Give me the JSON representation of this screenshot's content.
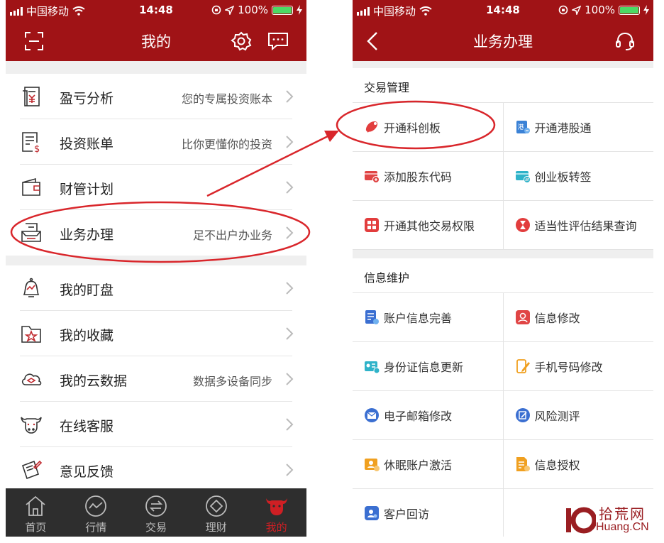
{
  "status": {
    "carrier": "中国移动",
    "time": "14:48",
    "battery": "100%"
  },
  "left": {
    "title": "我的",
    "menu": [
      {
        "label": "盈亏分析",
        "desc": "您的专属投资账本",
        "icon": "profit-analysis-icon"
      },
      {
        "label": "投资账单",
        "desc": "比你更懂你的投资",
        "icon": "investment-bill-icon"
      },
      {
        "label": "财管计划",
        "desc": "",
        "icon": "wallet-plan-icon"
      },
      {
        "label": "业务办理",
        "desc": "足不出户办业务",
        "icon": "business-handling-icon"
      },
      {
        "label": "我的盯盘",
        "desc": "",
        "icon": "bell-watch-icon"
      },
      {
        "label": "我的收藏",
        "desc": "",
        "icon": "favorites-star-icon"
      },
      {
        "label": "我的云数据",
        "desc": "数据多设备同步",
        "icon": "cloud-data-icon"
      },
      {
        "label": "在线客服",
        "desc": "",
        "icon": "bull-service-icon"
      },
      {
        "label": "意见反馈",
        "desc": "",
        "icon": "feedback-pen-icon"
      }
    ],
    "tabs": [
      {
        "label": "首页",
        "icon": "home-icon"
      },
      {
        "label": "行情",
        "icon": "market-icon"
      },
      {
        "label": "交易",
        "icon": "trade-icon"
      },
      {
        "label": "理财",
        "icon": "finance-icon"
      },
      {
        "label": "我的",
        "icon": "bull-head-icon",
        "active": true
      }
    ]
  },
  "right": {
    "title": "业务办理",
    "sections": [
      {
        "title": "交易管理",
        "items": [
          {
            "label": "开通科创板",
            "icon": "star-market-icon",
            "color": "#e23d3d"
          },
          {
            "label": "开通港股通",
            "icon": "hk-connect-icon",
            "color": "#3b82d6"
          },
          {
            "label": "添加股东代码",
            "icon": "shareholder-code-icon",
            "color": "#e04545"
          },
          {
            "label": "创业板转签",
            "icon": "gem-transfer-icon",
            "color": "#2fb3c9"
          },
          {
            "label": "开通其他交易权限",
            "icon": "other-permissions-icon",
            "color": "#e23d3d"
          },
          {
            "label": "适当性评估结果查询",
            "icon": "suitability-query-icon",
            "color": "#e23d3d"
          }
        ]
      },
      {
        "title": "信息维护",
        "items": [
          {
            "label": "账户信息完善",
            "icon": "account-info-icon",
            "color": "#3b6fd1"
          },
          {
            "label": "信息修改",
            "icon": "info-modify-icon",
            "color": "#e04545"
          },
          {
            "label": "身份证信息更新",
            "icon": "id-card-icon",
            "color": "#2fb3c9"
          },
          {
            "label": "手机号码修改",
            "icon": "phone-edit-icon",
            "color": "#f0a020"
          },
          {
            "label": "电子邮箱修改",
            "icon": "email-icon",
            "color": "#3b6fd1"
          },
          {
            "label": "风险测评",
            "icon": "risk-assessment-icon",
            "color": "#3b6fd1"
          },
          {
            "label": "休眠账户激活",
            "icon": "dormant-account-icon",
            "color": "#f0a020"
          },
          {
            "label": "信息授权",
            "icon": "info-authorize-icon",
            "color": "#f0a020"
          },
          {
            "label": "客户回访",
            "icon": "customer-visit-icon",
            "color": "#3b6fd1"
          },
          {
            "label": "",
            "icon": "",
            "color": ""
          }
        ]
      }
    ]
  },
  "watermark": {
    "cn": "拾荒网",
    "en": "Huang.CN"
  },
  "colors": {
    "brand_red": "#a01316",
    "annotation_red": "#d9262b",
    "tab_bar": "#2e2e2e"
  }
}
